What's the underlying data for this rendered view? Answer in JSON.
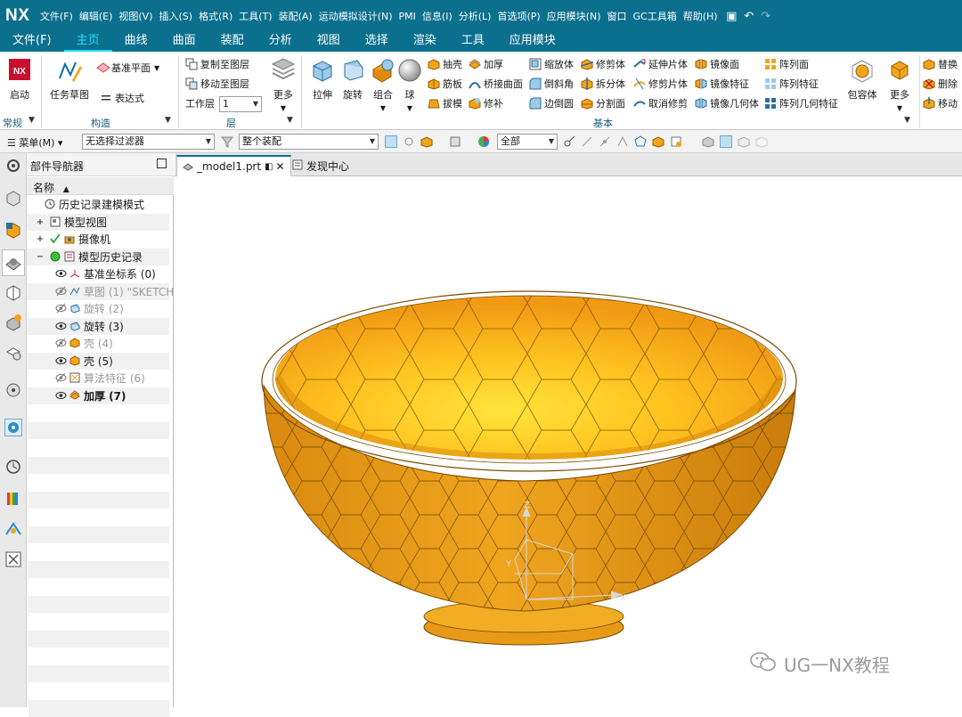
{
  "app": {
    "logo": "NX",
    "menu": [
      "文件(F)",
      "编辑(E)",
      "视图(V)",
      "插入(S)",
      "格式(R)",
      "工具(T)",
      "装配(A)",
      "运动模拟设计(N)",
      "PMI",
      "信息(I)",
      "分析(L)",
      "首选项(P)",
      "应用模块(N)",
      "窗口",
      "GC工具箱",
      "帮助(H)"
    ]
  },
  "ribbon": {
    "tabs": [
      "文件(F)",
      "主页",
      "曲线",
      "曲面",
      "装配",
      "分析",
      "视图",
      "选择",
      "渲染",
      "工具",
      "应用模块"
    ],
    "active_tab": "主页",
    "groups": {
      "changgui": "常规",
      "gouzao": "构造",
      "ceng": "层",
      "jiben": "基本"
    },
    "start_label": "启动",
    "task_sketch_label": "任务草图",
    "datum_plane_label": "基准平面",
    "expression_label": "表达式",
    "copy_layer_label": "复制至图层",
    "move_layer_label": "移动至图层",
    "work_layer_label": "工作层",
    "work_layer_value": "1",
    "more_label": "更多",
    "extrude_label": "拉伸",
    "revolve_label": "旋转",
    "combine_label": "组合",
    "sphere_label": "球",
    "shell_label": "抽壳",
    "rib_label": "筋板",
    "draft_label": "拔模",
    "thicken_label": "加厚",
    "bridge_label": "桥接曲面",
    "patch_label": "修补",
    "scale_label": "缩放体",
    "chamfer_label": "倒斜角",
    "edge_blend_label": "边倒圆",
    "trim_body_label": "修剪体",
    "split_body_label": "拆分体",
    "divide_face_label": "分割面",
    "extend_sheet_label": "延伸片体",
    "trim_sheet_label": "修剪片体",
    "untrim_label": "取消修剪",
    "mirror_face_label": "镜像面",
    "mirror_feature_label": "镜像特征",
    "mirror_geometry_label": "镜像几何体",
    "pattern_face_label": "阵列面",
    "pattern_feature_label": "阵列特征",
    "pattern_geometry_label": "阵列几何特征",
    "bounding_body_label": "包容体",
    "more2_label": "更多",
    "replace_label": "替换",
    "delete_label": "删除",
    "move_label": "移动"
  },
  "toolbar": {
    "menu_label": "菜单(M)",
    "filter_value": "无选择过滤器",
    "assembly_value": "整个装配",
    "scope_value": "全部"
  },
  "navigator": {
    "title": "部件导航器",
    "column_header": "名称",
    "rows": [
      {
        "label": "历史记录建模模式",
        "style": "normal"
      },
      {
        "label": "模型视图",
        "style": "normal"
      },
      {
        "label": "摄像机",
        "style": "normal"
      },
      {
        "label": "模型历史记录",
        "style": "normal"
      },
      {
        "label": "基准坐标系 (0)",
        "style": "normal"
      },
      {
        "label": "草图 (1) \"SKETCH",
        "style": "dim"
      },
      {
        "label": "旋转 (2)",
        "style": "dim"
      },
      {
        "label": "旋转 (3)",
        "style": "normal"
      },
      {
        "label": "壳 (4)",
        "style": "dim"
      },
      {
        "label": "壳 (5)",
        "style": "normal"
      },
      {
        "label": "算法特征 (6)",
        "style": "dim"
      },
      {
        "label": "加厚 (7)",
        "style": "bold"
      }
    ]
  },
  "doc_tabs": [
    {
      "label": "_model1.prt",
      "active": true
    },
    {
      "label": "发现中心",
      "active": false
    }
  ],
  "viewport": {
    "axis_x": "X",
    "axis_y": "Y",
    "axis_z": "Z",
    "model_color": "#f2a51a",
    "model_edge_color": "#7a4a00"
  },
  "watermark": "UG一NX教程",
  "colors": {
    "titlebar": "#0b6f8e",
    "active_tab": "#1ee0ff"
  }
}
